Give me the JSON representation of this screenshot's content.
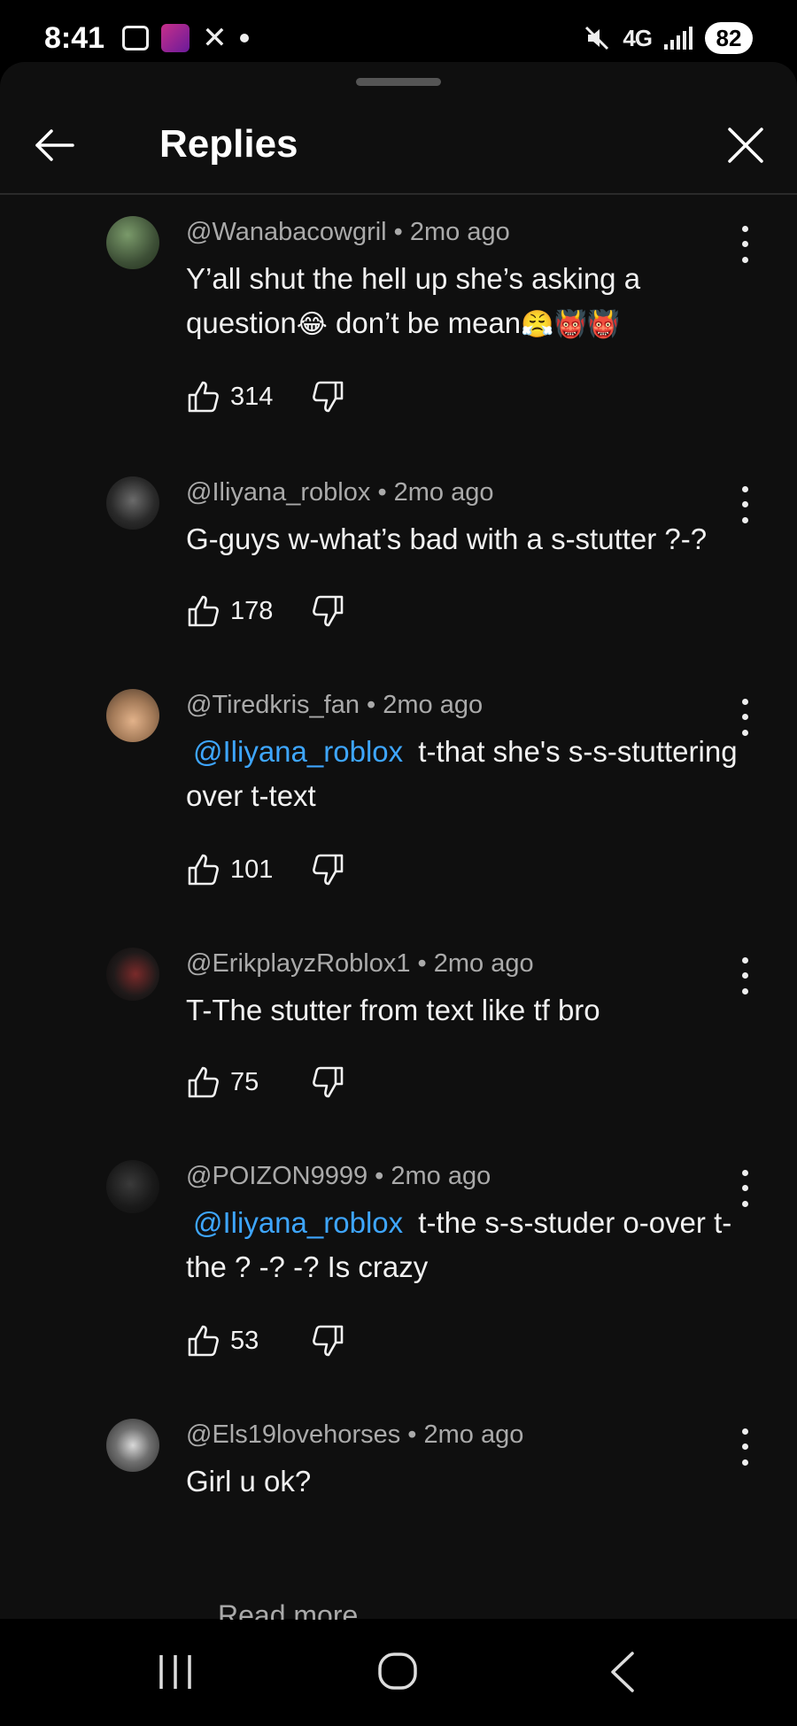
{
  "status_bar": {
    "time": "8:41",
    "network": "4G",
    "battery": "82"
  },
  "header": {
    "title": "Replies"
  },
  "comments": [
    {
      "meta": "@Wanabacowgril • 2mo ago",
      "text_parts": [
        "Y’all shut the hell up she’s asking a question",
        "😂",
        " don’t be mean",
        "😤",
        "👹",
        "👹"
      ],
      "likes": "314"
    },
    {
      "meta": "@Iliyana_roblox • 2mo ago",
      "text": "G-guys w-what’s bad with a s-stutter ?-?",
      "likes": "178"
    },
    {
      "meta": "@Tiredkris_fan • 2mo ago",
      "mention": "@Iliyana_roblox",
      "text": "t-that she's s-s-stuttering over t-text",
      "likes": "101"
    },
    {
      "meta": "@ErikplayzRoblox1 • 2mo ago",
      "text": "T-The stutter from text like tf bro",
      "likes": "75"
    },
    {
      "meta": "@POIZON9999 • 2mo ago",
      "mention": "@Iliyana_roblox",
      "text": "t-the s-s-studer o-over t-the  ? -? -?  Is crazy",
      "likes": "53"
    },
    {
      "meta": "@Els19lovehorses • 2mo ago",
      "text": "Girl u ok?"
    }
  ],
  "read_more": "Read more",
  "colors": {
    "background": "#0f0f0f",
    "mention": "#3ea6ff",
    "secondary_text": "#aaaaaa"
  },
  "icons": [
    "back-arrow-icon",
    "close-icon",
    "thumbs-up-icon",
    "thumbs-down-icon",
    "more-vertical-icon",
    "recents-icon",
    "home-icon",
    "back-chevron-icon"
  ]
}
